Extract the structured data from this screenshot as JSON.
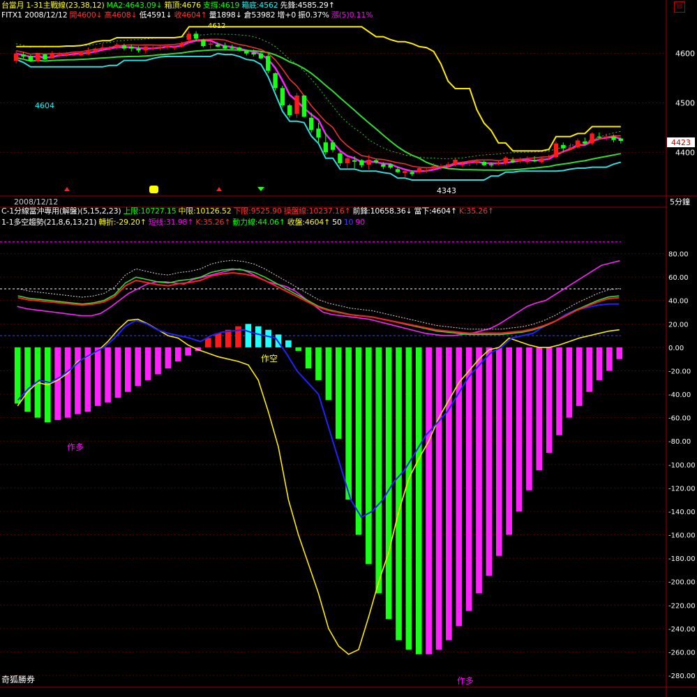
{
  "header": {
    "line1": [
      {
        "text": "台當月",
        "color": "#ffff00"
      },
      {
        "text": "1-31主戰線(23,38,12)",
        "color": "#ffff00"
      },
      {
        "text": "MA2:4643.09↓",
        "color": "#00ff00"
      },
      {
        "text": "箱頂:4676",
        "color": "#ffff00"
      },
      {
        "text": "支撐:4619",
        "color": "#00ff00"
      },
      {
        "text": "箱底:4562",
        "color": "#00ffff"
      },
      {
        "text": "先鋒:4585.29↑",
        "color": "#ffffff"
      }
    ],
    "line2": [
      {
        "text": "FITX1 2008/12/12",
        "color": "#ffffff"
      },
      {
        "text": "開4600↓",
        "color": "#ff3030"
      },
      {
        "text": "高4608↓",
        "color": "#ff3030"
      },
      {
        "text": "低4591↓",
        "color": "#ffffff"
      },
      {
        "text": "收4604↑",
        "color": "#ff3030"
      },
      {
        "text": "量1898↓",
        "color": "#ffffff"
      },
      {
        "text": "倉53982",
        "color": "#ffffff"
      },
      {
        "text": "增+0",
        "color": "#ffffff"
      },
      {
        "text": "振0.37%",
        "color": "#ffffff"
      },
      {
        "text": "漲(5)0.11%",
        "color": "#ff00ff"
      }
    ],
    "line3": [
      {
        "text": "C-1分線當沖專用(解盤)(5,15,2,23)",
        "color": "#ffffff"
      },
      {
        "text": "上限:10727.15",
        "color": "#00ff00"
      },
      {
        "text": "中限:10126.52",
        "color": "#ffff00"
      },
      {
        "text": "下限:9525.90",
        "color": "#ff3030"
      },
      {
        "text": "操盤線:10237.16↑",
        "color": "#ff3030"
      },
      {
        "text": "前鋒:10658.36↓",
        "color": "#ffffff"
      },
      {
        "text": "當下:4604↑",
        "color": "#ffffff"
      },
      {
        "text": "K:35.26↑",
        "color": "#ff3030"
      }
    ],
    "line4": [
      {
        "text": "1-1多空趨勢(21,8,6,13,21)",
        "color": "#ffffff"
      },
      {
        "text": "轉折:-29.20↑",
        "color": "#ffff00"
      },
      {
        "text": "短线:31.98↑",
        "color": "#ff00ff"
      },
      {
        "text": "K:35.26↑",
        "color": "#ff3030"
      },
      {
        "text": "動力線:44.06↑",
        "color": "#00ff00"
      },
      {
        "text": "收盤:4604↑",
        "color": "#ffff00"
      },
      {
        "text": "50",
        "color": "#ffffff"
      },
      {
        "text": "10",
        "color": "#4040ff"
      },
      {
        "text": "90",
        "color": "#ff00ff"
      }
    ]
  },
  "labels": {
    "date": "2008/12/12",
    "period": "5分鐘",
    "brand": "奇狐勝券",
    "left_price": "4604",
    "low_label": "4343",
    "high_label": "4612",
    "current_price": "4423",
    "short_marker": "作空",
    "long_marker_1": "作多",
    "long_marker_2": "作多"
  },
  "chart_data": [
    {
      "type": "candlestick",
      "y_ticks": [
        4600,
        4500,
        4400
      ],
      "ylim": [
        4320,
        4680
      ],
      "current_price": 4423,
      "candles": [
        {
          "o": 4585,
          "h": 4605,
          "l": 4580,
          "c": 4600
        },
        {
          "o": 4598,
          "h": 4603,
          "l": 4590,
          "c": 4594
        },
        {
          "o": 4595,
          "h": 4597,
          "l": 4583,
          "c": 4585
        },
        {
          "o": 4585,
          "h": 4600,
          "l": 4582,
          "c": 4599
        },
        {
          "o": 4598,
          "h": 4600,
          "l": 4587,
          "c": 4588
        },
        {
          "o": 4590,
          "h": 4605,
          "l": 4590,
          "c": 4600
        },
        {
          "o": 4598,
          "h": 4603,
          "l": 4592,
          "c": 4598
        },
        {
          "o": 4596,
          "h": 4603,
          "l": 4594,
          "c": 4601
        },
        {
          "o": 4597,
          "h": 4604,
          "l": 4595,
          "c": 4598
        },
        {
          "o": 4596,
          "h": 4605,
          "l": 4594,
          "c": 4602
        },
        {
          "o": 4598,
          "h": 4612,
          "l": 4597,
          "c": 4605
        },
        {
          "o": 4604,
          "h": 4612,
          "l": 4600,
          "c": 4610
        },
        {
          "o": 4610,
          "h": 4620,
          "l": 4605,
          "c": 4612
        },
        {
          "o": 4610,
          "h": 4615,
          "l": 4606,
          "c": 4612
        },
        {
          "o": 4612,
          "h": 4622,
          "l": 4608,
          "c": 4618
        },
        {
          "o": 4616,
          "h": 4620,
          "l": 4606,
          "c": 4610
        },
        {
          "o": 4614,
          "h": 4618,
          "l": 4604,
          "c": 4610
        },
        {
          "o": 4610,
          "h": 4615,
          "l": 4602,
          "c": 4606
        },
        {
          "o": 4606,
          "h": 4618,
          "l": 4600,
          "c": 4614
        },
        {
          "o": 4612,
          "h": 4618,
          "l": 4606,
          "c": 4612
        },
        {
          "o": 4610,
          "h": 4618,
          "l": 4606,
          "c": 4614
        },
        {
          "o": 4612,
          "h": 4618,
          "l": 4608,
          "c": 4615
        },
        {
          "o": 4611,
          "h": 4616,
          "l": 4607,
          "c": 4614
        },
        {
          "o": 4614,
          "h": 4624,
          "l": 4612,
          "c": 4620
        },
        {
          "o": 4628,
          "h": 4645,
          "l": 4620,
          "c": 4640
        },
        {
          "o": 4640,
          "h": 4645,
          "l": 4625,
          "c": 4630
        },
        {
          "o": 4628,
          "h": 4630,
          "l": 4612,
          "c": 4615
        },
        {
          "o": 4618,
          "h": 4625,
          "l": 4610,
          "c": 4620
        },
        {
          "o": 4618,
          "h": 4622,
          "l": 4612,
          "c": 4614
        },
        {
          "o": 4616,
          "h": 4622,
          "l": 4608,
          "c": 4610
        },
        {
          "o": 4612,
          "h": 4618,
          "l": 4606,
          "c": 4610
        },
        {
          "o": 4612,
          "h": 4614,
          "l": 4604,
          "c": 4606
        },
        {
          "o": 4606,
          "h": 4608,
          "l": 4596,
          "c": 4600
        },
        {
          "o": 4602,
          "h": 4608,
          "l": 4594,
          "c": 4598
        },
        {
          "o": 4600,
          "h": 4604,
          "l": 4588,
          "c": 4590
        },
        {
          "o": 4595,
          "h": 4600,
          "l": 4560,
          "c": 4565
        },
        {
          "o": 4560,
          "h": 4562,
          "l": 4525,
          "c": 4530
        },
        {
          "o": 4530,
          "h": 4535,
          "l": 4490,
          "c": 4495
        },
        {
          "o": 4495,
          "h": 4498,
          "l": 4470,
          "c": 4475
        },
        {
          "o": 4478,
          "h": 4520,
          "l": 4470,
          "c": 4515
        },
        {
          "o": 4515,
          "h": 4516,
          "l": 4470,
          "c": 4472
        },
        {
          "o": 4470,
          "h": 4480,
          "l": 4440,
          "c": 4445
        },
        {
          "o": 4448,
          "h": 4460,
          "l": 4420,
          "c": 4430
        },
        {
          "o": 4420,
          "h": 4440,
          "l": 4395,
          "c": 4400
        },
        {
          "o": 4420,
          "h": 4425,
          "l": 4400,
          "c": 4405
        },
        {
          "o": 4398,
          "h": 4402,
          "l": 4372,
          "c": 4378
        },
        {
          "o": 4378,
          "h": 4390,
          "l": 4368,
          "c": 4388
        },
        {
          "o": 4384,
          "h": 4392,
          "l": 4368,
          "c": 4381
        },
        {
          "o": 4384,
          "h": 4386,
          "l": 4369,
          "c": 4374
        },
        {
          "o": 4375,
          "h": 4395,
          "l": 4365,
          "c": 4385
        },
        {
          "o": 4384,
          "h": 4386,
          "l": 4377,
          "c": 4380
        },
        {
          "o": 4376,
          "h": 4380,
          "l": 4366,
          "c": 4371
        },
        {
          "o": 4376,
          "h": 4378,
          "l": 4366,
          "c": 4369
        },
        {
          "o": 4366,
          "h": 4370,
          "l": 4358,
          "c": 4360
        },
        {
          "o": 4358,
          "h": 4365,
          "l": 4350,
          "c": 4362
        },
        {
          "o": 4360,
          "h": 4364,
          "l": 4352,
          "c": 4356
        },
        {
          "o": 4360,
          "h": 4372,
          "l": 4356,
          "c": 4368
        },
        {
          "o": 4362,
          "h": 4370,
          "l": 4358,
          "c": 4364
        },
        {
          "o": 4368,
          "h": 4378,
          "l": 4364,
          "c": 4372
        },
        {
          "o": 4370,
          "h": 4376,
          "l": 4364,
          "c": 4372
        },
        {
          "o": 4374,
          "h": 4380,
          "l": 4368,
          "c": 4376
        },
        {
          "o": 4376,
          "h": 4388,
          "l": 4372,
          "c": 4385
        },
        {
          "o": 4376,
          "h": 4382,
          "l": 4370,
          "c": 4376
        },
        {
          "o": 4378,
          "h": 4384,
          "l": 4372,
          "c": 4380
        },
        {
          "o": 4378,
          "h": 4386,
          "l": 4374,
          "c": 4383
        },
        {
          "o": 4381,
          "h": 4383,
          "l": 4372,
          "c": 4374
        },
        {
          "o": 4376,
          "h": 4380,
          "l": 4370,
          "c": 4375
        },
        {
          "o": 4378,
          "h": 4384,
          "l": 4374,
          "c": 4378
        },
        {
          "o": 4378,
          "h": 4392,
          "l": 4374,
          "c": 4389
        },
        {
          "o": 4384,
          "h": 4390,
          "l": 4378,
          "c": 4380
        },
        {
          "o": 4382,
          "h": 4390,
          "l": 4378,
          "c": 4386
        },
        {
          "o": 4380,
          "h": 4392,
          "l": 4376,
          "c": 4384
        },
        {
          "o": 4384,
          "h": 4392,
          "l": 4380,
          "c": 4382
        },
        {
          "o": 4380,
          "h": 4390,
          "l": 4378,
          "c": 4388
        },
        {
          "o": 4390,
          "h": 4395,
          "l": 4385,
          "c": 4392
        },
        {
          "o": 4390,
          "h": 4422,
          "l": 4388,
          "c": 4418
        },
        {
          "o": 4415,
          "h": 4420,
          "l": 4400,
          "c": 4408
        },
        {
          "o": 4408,
          "h": 4418,
          "l": 4405,
          "c": 4410
        },
        {
          "o": 4410,
          "h": 4428,
          "l": 4408,
          "c": 4424
        },
        {
          "o": 4422,
          "h": 4430,
          "l": 4415,
          "c": 4418
        },
        {
          "o": 4418,
          "h": 4440,
          "l": 4415,
          "c": 4438
        },
        {
          "o": 4432,
          "h": 4440,
          "l": 4428,
          "c": 4430
        },
        {
          "o": 4430,
          "h": 4438,
          "l": 4424,
          "c": 4432
        },
        {
          "o": 4432,
          "h": 4436,
          "l": 4420,
          "c": 4425
        },
        {
          "o": 4428,
          "h": 4430,
          "l": 4418,
          "c": 4423
        }
      ]
    },
    {
      "type": "bar",
      "ylim": [
        -280,
        100
      ],
      "y_ticks": [
        80,
        60,
        40,
        20,
        0,
        -20,
        -40,
        -60,
        -80,
        -100,
        -120,
        -140,
        -160,
        -180,
        -200,
        -220,
        -240,
        -260,
        -280
      ],
      "bars": [
        -48,
        -55,
        -60,
        -64,
        -62,
        -60,
        -57,
        -55,
        -50,
        -47,
        -43,
        -38,
        -33,
        -28,
        -23,
        -18,
        -12,
        -7,
        -3,
        8,
        12,
        15,
        18,
        20,
        18,
        15,
        11,
        6,
        -3,
        -18,
        -28,
        -45,
        -78,
        -130,
        -160,
        -185,
        -210,
        -232,
        -250,
        -258,
        -262,
        -262,
        -258,
        -250,
        -238,
        -225,
        -210,
        -195,
        -178,
        -160,
        -140,
        -122,
        -105,
        -90,
        -75,
        -60,
        -50,
        -38,
        -28,
        -20,
        -10
      ],
      "bar_colors": [
        "g",
        "g",
        "g",
        "g",
        "m",
        "m",
        "m",
        "m",
        "m",
        "m",
        "m",
        "m",
        "m",
        "m",
        "m",
        "m",
        "m",
        "m",
        "m",
        "r",
        "r",
        "r",
        "r",
        "c",
        "c",
        "c",
        "c",
        "c",
        "g",
        "g",
        "g",
        "g",
        "g",
        "g",
        "g",
        "g",
        "g",
        "g",
        "g",
        "g",
        "g",
        "m",
        "m",
        "m",
        "m",
        "m",
        "m",
        "m",
        "m",
        "m",
        "m",
        "m",
        "m",
        "m",
        "m",
        "m",
        "m",
        "m",
        "m",
        "m",
        "m"
      ],
      "series": [
        {
          "values": [
            -50,
            -38,
            -30,
            -32,
            -28,
            -22,
            -12,
            -8,
            -3,
            5,
            15,
            23,
            24,
            20,
            15,
            10,
            8,
            2,
            -2,
            -5,
            -8,
            -10,
            -12,
            -15,
            -28,
            -55,
            -85,
            -130,
            -160,
            -185,
            -210,
            -240,
            -255,
            -262,
            -258,
            -230,
            -200,
            -175,
            -140,
            -112,
            -95,
            -80,
            -60,
            -45,
            -30,
            -20,
            -10,
            -2,
            0,
            8,
            5,
            2,
            0,
            0,
            2,
            5,
            8,
            10,
            12,
            14,
            15
          ]
        },
        {
          "values": [
            -45,
            -35,
            -28,
            -30,
            -25,
            -18,
            -10,
            -5,
            0,
            8,
            18,
            23,
            20,
            15,
            12,
            10,
            8,
            5,
            10,
            13,
            14,
            15,
            12,
            10,
            8,
            -5,
            -20,
            -30,
            -40,
            -70,
            -100,
            -130,
            -145,
            -140,
            -130,
            -115,
            -105,
            -90,
            -75,
            -65,
            -55,
            -40,
            -25,
            -15,
            -5,
            0,
            8,
            10,
            12,
            18,
            22,
            28,
            32,
            34,
            36,
            37,
            37
          ]
        },
        {
          "values": [
            35,
            33,
            32,
            31,
            30,
            29,
            28,
            27,
            27,
            29,
            34,
            40,
            46,
            50,
            54,
            56,
            56,
            55,
            54,
            58,
            60,
            62,
            64,
            66,
            67,
            64,
            60,
            56,
            54,
            52,
            48,
            42,
            36,
            30,
            28,
            27,
            26,
            25,
            24,
            22,
            20,
            18,
            16,
            14,
            12,
            11,
            10,
            10,
            11,
            12,
            14,
            16,
            20,
            25,
            30,
            35,
            38,
            40,
            45,
            50,
            55,
            60,
            65,
            70,
            72,
            74
          ]
        },
        {
          "values": [
            44,
            42,
            41,
            40,
            39,
            38,
            37,
            38,
            40,
            45,
            55,
            60,
            58,
            56,
            55,
            57,
            58,
            60,
            64,
            66,
            67,
            66,
            64,
            60,
            55,
            50,
            45,
            40,
            35,
            32,
            30,
            28,
            27,
            26,
            24,
            22,
            20,
            18,
            16,
            14,
            13,
            12,
            11,
            11,
            11,
            11,
            12,
            13,
            15,
            18,
            22,
            27,
            32,
            36,
            40,
            43,
            44
          ]
        }
      ],
      "markers": [
        "作空",
        "作多",
        "作多"
      ]
    }
  ]
}
